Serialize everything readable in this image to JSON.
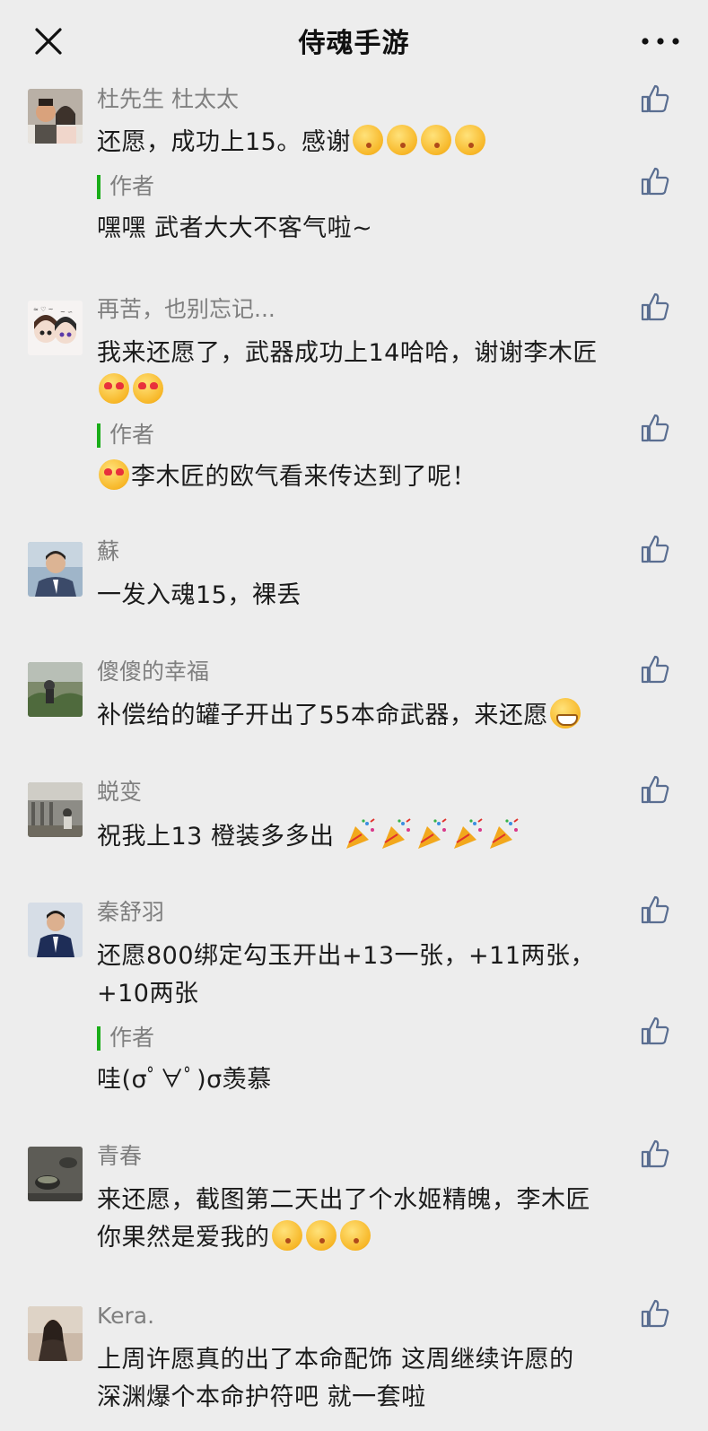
{
  "header": {
    "title": "侍魂手游"
  },
  "comments": [
    {
      "name": "杜先生 杜太太",
      "text": "还愿，成功上15。感谢",
      "reply_label": "作者",
      "reply_text": "嘿嘿 武者大大不客气啦~"
    },
    {
      "name": "再苦，也别忘记...",
      "text": "我来还愿了，武器成功上14哈哈，谢谢李木匠",
      "reply_label": "作者",
      "reply_text": "李木匠的欧气看来传达到了呢！"
    },
    {
      "name": "蘇",
      "text": "一发入魂15，裸丢"
    },
    {
      "name": "傻傻的幸福",
      "text": "补偿给的罐子开出了55本命武器，来还愿"
    },
    {
      "name": "蜕变",
      "text": "祝我上13 橙装多多出"
    },
    {
      "name": "秦舒羽",
      "text_line1": "还愿800绑定勾玉开出+13一张，+11两张，",
      "text_line2": "+10两张",
      "reply_label": "作者",
      "reply_text": "哇(σﾟ∀ﾟ)σ羡慕"
    },
    {
      "name": "青春",
      "text_line1": "来还愿，截图第二天出了个水姬精魄，李木匠",
      "text_line2": "你果然是爱我的"
    },
    {
      "name": "Kera.",
      "text_line1": "上周许愿真的出了本命配饰 这周继续许愿的",
      "text_line2": "深渊爆个本命护符吧 就一套啦"
    }
  ],
  "colors": {
    "background": "#ededed",
    "author_bar": "#1aad19",
    "name_text": "#7f7f7f",
    "body_text": "#1b1b1b",
    "like_icon": "#5a6e91"
  }
}
